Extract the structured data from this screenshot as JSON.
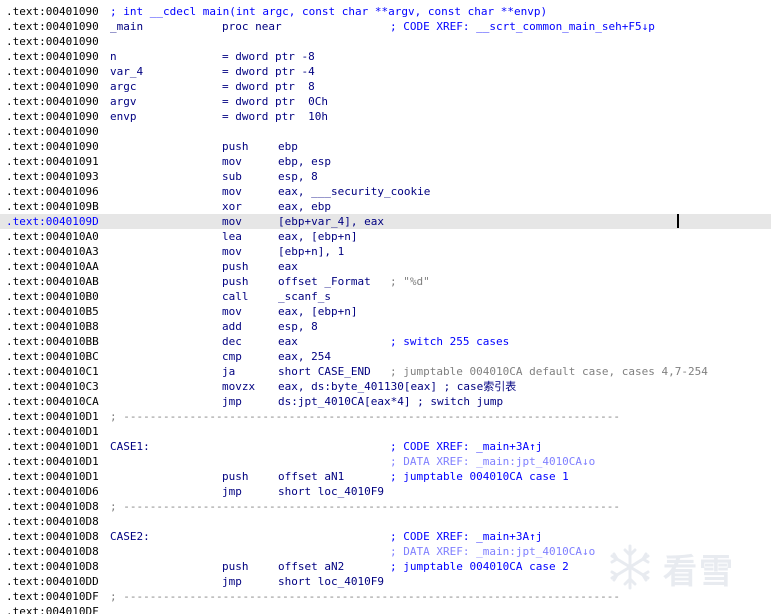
{
  "lines": [
    {
      "addr": ".text:00401090",
      "proto": "; int __cdecl main(int argc, const char **argv, const char **envp)"
    },
    {
      "addr": ".text:00401090",
      "name": "_main",
      "mnemonic": "proc near",
      "comment": "; CODE XREF: __scrt_common_main_seh+F5↓p"
    },
    {
      "addr": ".text:00401090"
    },
    {
      "addr": ".text:00401090",
      "name": "n",
      "equ": "= dword ptr -8"
    },
    {
      "addr": ".text:00401090",
      "name": "var_4",
      "equ": "= dword ptr -4"
    },
    {
      "addr": ".text:00401090",
      "name": "argc",
      "equ": "= dword ptr  8"
    },
    {
      "addr": ".text:00401090",
      "name": "argv",
      "equ": "= dword ptr  0Ch"
    },
    {
      "addr": ".text:00401090",
      "name": "envp",
      "equ": "= dword ptr  10h"
    },
    {
      "addr": ".text:00401090"
    },
    {
      "addr": ".text:00401090",
      "mnemonic": "push",
      "operands": "ebp"
    },
    {
      "addr": ".text:00401091",
      "mnemonic": "mov",
      "operands": "ebp, esp"
    },
    {
      "addr": ".text:00401093",
      "mnemonic": "sub",
      "operands": "esp, 8"
    },
    {
      "addr": ".text:00401096",
      "mnemonic": "mov",
      "operands": "eax, ___security_cookie"
    },
    {
      "addr": ".text:0040109B",
      "mnemonic": "xor",
      "operands": "eax, ebp"
    },
    {
      "addr": ".text:0040109D",
      "mnemonic": "mov",
      "operands": "[ebp+var_4], eax",
      "highlight": true
    },
    {
      "addr": ".text:004010A0",
      "mnemonic": "lea",
      "operands": "eax, [ebp+n]"
    },
    {
      "addr": ".text:004010A3",
      "mnemonic": "mov",
      "operands": "[ebp+n], 1"
    },
    {
      "addr": ".text:004010AA",
      "mnemonic": "push",
      "operands": "eax"
    },
    {
      "addr": ".text:004010AB",
      "mnemonic": "push",
      "operands": "offset _Format",
      "comment": "; \"%d\"",
      "comment_style": "gray"
    },
    {
      "addr": ".text:004010B0",
      "mnemonic": "call",
      "operands": "_scanf_s"
    },
    {
      "addr": ".text:004010B5",
      "mnemonic": "mov",
      "operands": "eax, [ebp+n]"
    },
    {
      "addr": ".text:004010B8",
      "mnemonic": "add",
      "operands": "esp, 8"
    },
    {
      "addr": ".text:004010BB",
      "mnemonic": "dec",
      "operands": "eax",
      "comment": "; switch 255 cases"
    },
    {
      "addr": ".text:004010BC",
      "mnemonic": "cmp",
      "operands": "eax, 254"
    },
    {
      "addr": ".text:004010C1",
      "mnemonic": "ja",
      "operands": "short CASE_END",
      "comment": "; jumptable 004010CA default case, cases 4,7-254",
      "comment_style": "gray"
    },
    {
      "addr": ".text:004010C3",
      "mnemonic": "movzx",
      "operands": "eax, ds:byte_401130[eax] ; case索引表"
    },
    {
      "addr": ".text:004010CA",
      "mnemonic": "jmp",
      "operands": "ds:jpt_4010CA[eax*4] ; switch jump"
    },
    {
      "addr": ".text:004010D1",
      "separator": "; ---------------------------------------------------------------------------"
    },
    {
      "addr": ".text:004010D1"
    },
    {
      "addr": ".text:004010D1",
      "name": "CASE1:",
      "comment": "; CODE XREF: _main+3A↑j"
    },
    {
      "addr": ".text:004010D1",
      "comment": "; DATA XREF: _main:jpt_4010CA↓o",
      "comment_style": "data"
    },
    {
      "addr": ".text:004010D1",
      "mnemonic": "push",
      "operands": "offset aN1",
      "comment": "; jumptable 004010CA case 1"
    },
    {
      "addr": ".text:004010D6",
      "mnemonic": "jmp",
      "operands": "short loc_4010F9"
    },
    {
      "addr": ".text:004010D8",
      "separator": "; ---------------------------------------------------------------------------"
    },
    {
      "addr": ".text:004010D8"
    },
    {
      "addr": ".text:004010D8",
      "name": "CASE2:",
      "comment": "; CODE XREF: _main+3A↑j"
    },
    {
      "addr": ".text:004010D8",
      "comment": "; DATA XREF: _main:jpt_4010CA↓o",
      "comment_style": "data"
    },
    {
      "addr": ".text:004010D8",
      "mnemonic": "push",
      "operands": "offset aN2",
      "comment": "; jumptable 004010CA case 2"
    },
    {
      "addr": ".text:004010DD",
      "mnemonic": "jmp",
      "operands": "short loc_4010F9"
    },
    {
      "addr": ".text:004010DF",
      "separator": "; ---------------------------------------------------------------------------"
    },
    {
      "addr": ".text:004010DF"
    }
  ],
  "watermark": {
    "text": "看雪",
    "icon": "snowflake-icon"
  }
}
